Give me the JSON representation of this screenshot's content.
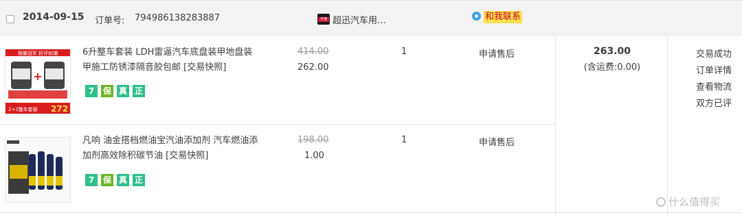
{
  "order": {
    "date": "2014-09-15",
    "order_label": "订单号:",
    "order_no": "794986138283887",
    "shop_badge": "天猫",
    "shop_name": "超迅汽车用…",
    "contact_label": "和我联系",
    "total": "263.00",
    "shipping": "(含运费:0.00)",
    "status_links": [
      "交易成功",
      "订单详情",
      "查看物流",
      "双方已评"
    ]
  },
  "items": [
    {
      "title": "6升整车套装 LDH雷逼汽车底盘装甲地盘装甲施工防锈漆隔音胶包邮",
      "snapshot": "[交易快照]",
      "price_old": "414.00",
      "price_new": "262.00",
      "qty": "1",
      "after_sale": "申请售后",
      "badges": [
        "7",
        "保",
        "真",
        "正"
      ],
      "image_top_text": "销量冠军 好评如潮",
      "image_bottom_text": "2+2整车套装",
      "image_price": "272"
    },
    {
      "title": "凡响 油金搭档燃油宝汽油添加剂 汽车燃油添加剂高效除积碳节油",
      "snapshot": "[交易快照]",
      "price_old": "198.00",
      "price_new": "1.00",
      "qty": "1",
      "after_sale": "申请售后",
      "badges": [
        "7",
        "保",
        "真",
        "正"
      ]
    }
  ],
  "watermark": "什么值得买",
  "colors": {
    "header_bg": "#f3f3f3",
    "contact_bg": "#ffe04f",
    "contact_text": "#c60023",
    "badge_green": "#2ec08b",
    "badge_yellowgreen": "#6fb424"
  }
}
